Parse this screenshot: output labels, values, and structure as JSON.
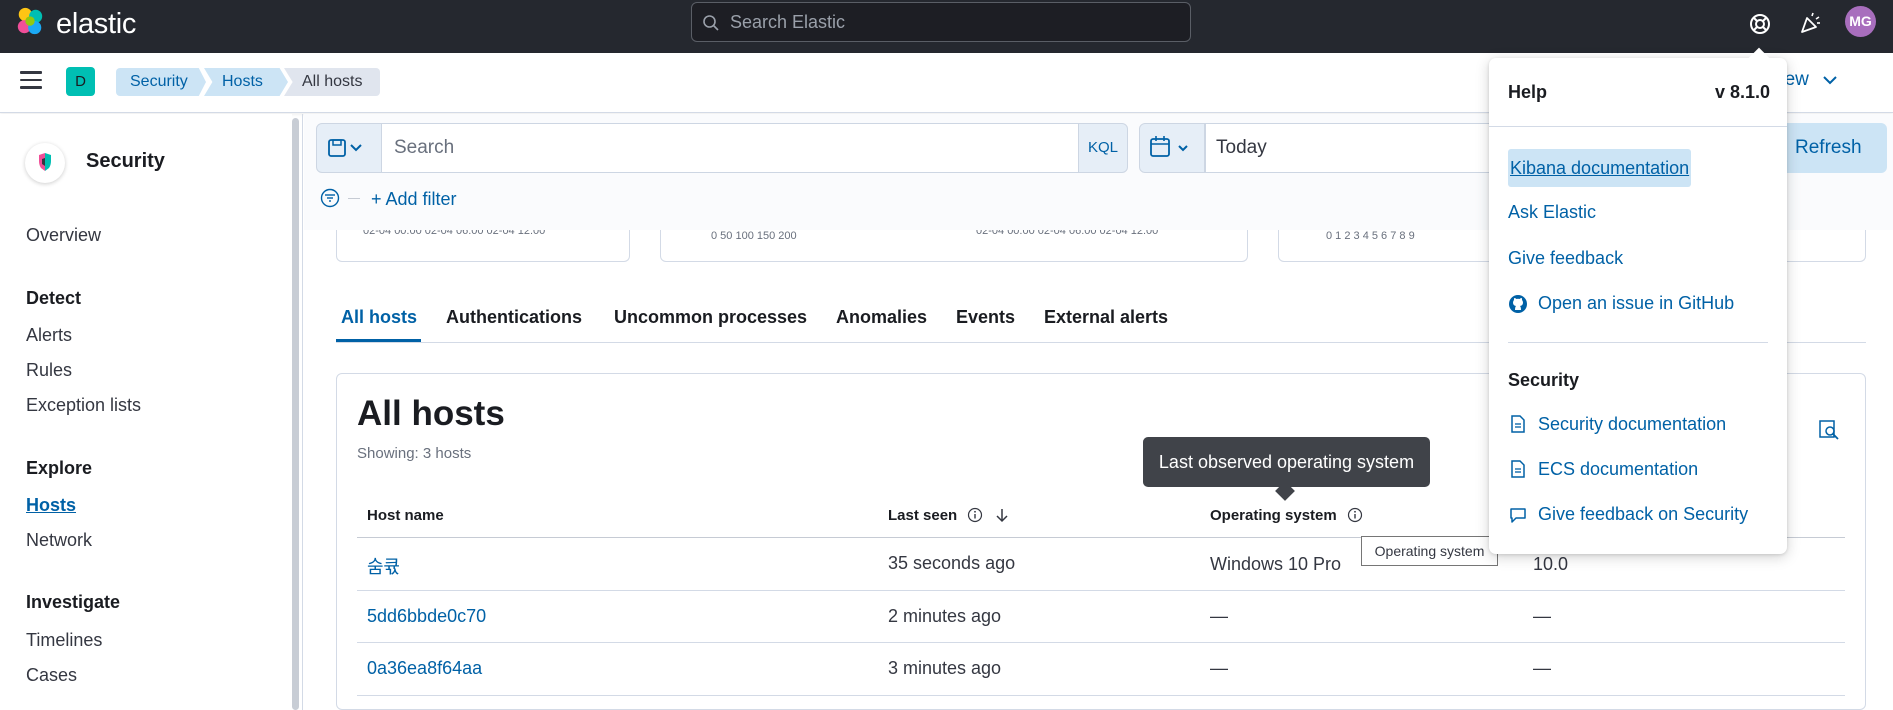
{
  "topbar": {
    "brand": "elastic",
    "search_placeholder": "Search Elastic",
    "avatar_initials": "MG"
  },
  "breadcrumbs": {
    "space_badge": "D",
    "items": [
      "Security",
      "Hosts",
      "All hosts"
    ]
  },
  "header": {
    "data_view_label": "a view"
  },
  "sidebar": {
    "title": "Security",
    "overview": "Overview",
    "sections": [
      {
        "heading": "Detect",
        "items": [
          "Alerts",
          "Rules",
          "Exception lists"
        ]
      },
      {
        "heading": "Explore",
        "items": [
          "Hosts",
          "Network"
        ]
      },
      {
        "heading": "Investigate",
        "items": [
          "Timelines",
          "Cases"
        ]
      }
    ],
    "active_item": "Hosts"
  },
  "querybar": {
    "search_placeholder": "Search",
    "language": "KQL",
    "date": "Today",
    "refresh_label": "Refresh",
    "add_filter": "+ Add filter"
  },
  "stat_panels": {
    "ticks_left": "02-04 00:00   02-04 06:00   02-04 12:00",
    "ticks_mid_a": "0        50      100      150      200",
    "ticks_mid_b": "02-04 00:00   02-04 06:00   02-04 12:00",
    "ticks_right": "0   1   2   3   4   5   6   7   8   9"
  },
  "tabs": [
    "All hosts",
    "Authentications",
    "Uncommon processes",
    "Anomalies",
    "Events",
    "External alerts"
  ],
  "table": {
    "title": "All hosts",
    "showing": "Showing: 3 hosts",
    "columns": [
      "Host name",
      "Last seen",
      "Operating system"
    ],
    "rows": [
      {
        "host": "숨큓",
        "last_seen": "35 seconds ago",
        "os": "Windows 10 Pro",
        "version": "10.0"
      },
      {
        "host": "5dd6bbde0c70",
        "last_seen": "2 minutes ago",
        "os": "—",
        "version": "—"
      },
      {
        "host": "0a36ea8f64aa",
        "last_seen": "3 minutes ago",
        "os": "—",
        "version": "—"
      }
    ]
  },
  "tooltip": "Last observed operating system",
  "native_tooltip": "Operating system",
  "help": {
    "title": "Help",
    "version": "v 8.1.0",
    "links": [
      "Kibana documentation",
      "Ask Elastic",
      "Give feedback",
      "Open an issue in GitHub"
    ],
    "security_heading": "Security",
    "security_links": [
      "Security documentation",
      "ECS documentation",
      "Give feedback on Security"
    ]
  },
  "colors": {
    "topbar": "#25282f",
    "link": "#0061a6",
    "space_badge": "#00bfb3",
    "avatar": "#a86ebd"
  }
}
